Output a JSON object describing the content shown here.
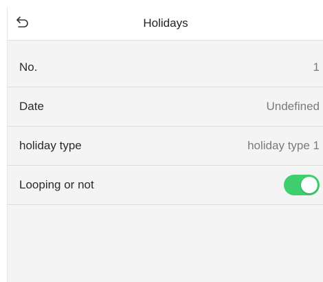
{
  "header": {
    "title": "Holidays",
    "back_icon": "back-arrow-icon"
  },
  "rows": [
    {
      "label": "No.",
      "value": "1"
    },
    {
      "label": "Date",
      "value": "Undefined"
    },
    {
      "label": "holiday type",
      "value": "holiday type 1"
    },
    {
      "label": "Looping or not",
      "toggle_on": true
    }
  ],
  "colors": {
    "toggle_on": "#3ecf6e",
    "background": "#f4f4f4",
    "header": "#ffffff"
  }
}
